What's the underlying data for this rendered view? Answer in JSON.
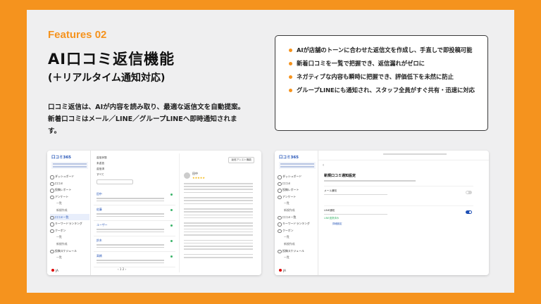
{
  "feature_tag": "Features 02",
  "title": "AI口コミ返信機能",
  "subtitle": "(＋リアルタイム通知対応)",
  "description": [
    "口コミ返信は、AIが内容を読み取り、最適な返信文を自動提案。",
    "新着口コミはメール／LINE／グループLINEへ即時通知されま",
    "す。"
  ],
  "bullets": [
    "AIが店舗のトーンに合わせた返信文を作成し、手直しで即投稿可能",
    "新着口コミを一覧で把握でき、返信漏れがゼロに",
    "ネガティブな内容も瞬時に把握でき、評価低下を未然に防止",
    "グループLINEにも通知され、スタッフ全員がすぐ共有・迅速に対応"
  ],
  "colors": {
    "accent": "#F5931E",
    "brand_blue": "#1E4FB5",
    "panel": "#EFEFF0"
  },
  "app": {
    "logo": "口コミ365",
    "sidebar": [
      {
        "label": "ダッシュボード",
        "sub": false
      },
      {
        "label": "口コミ",
        "sub": false
      },
      {
        "label": "投稿レポート",
        "sub": false
      },
      {
        "label": "アンケート",
        "sub": false
      },
      {
        "label": "一覧",
        "sub": true
      },
      {
        "label": "新規作成",
        "sub": true
      },
      {
        "label": "口コミ一覧",
        "sub": false,
        "active": true
      },
      {
        "label": "キーワードランキング",
        "sub": false
      },
      {
        "label": "クーポン",
        "sub": false
      },
      {
        "label": "一覧",
        "sub": true
      },
      {
        "label": "新規作成",
        "sub": true
      },
      {
        "label": "投稿スケジュール",
        "sub": false
      },
      {
        "label": "一覧",
        "sub": true
      }
    ],
    "lang": "JA",
    "filters": {
      "label": "返信状態",
      "opt1": "未返信",
      "opt2": "返信済",
      "opt3": "すべて",
      "select": "口コミ"
    },
    "reviews": [
      {
        "name": "田中"
      },
      {
        "name": "佐藤"
      },
      {
        "name": "ユーザー"
      },
      {
        "name": "鈴木"
      },
      {
        "name": "高橋"
      }
    ],
    "pager": "‹  1  2  ›",
    "detail": {
      "app_btn": "返信アシスト機能",
      "name": "田中",
      "stars": "★★★★★"
    },
    "settings": {
      "back": "‹",
      "title": "新規口コミ通知設定",
      "mail_label": "メール通知",
      "line_label": "LINE通知",
      "link": "LINE連携済み",
      "setbtn": "詳細設定"
    }
  }
}
